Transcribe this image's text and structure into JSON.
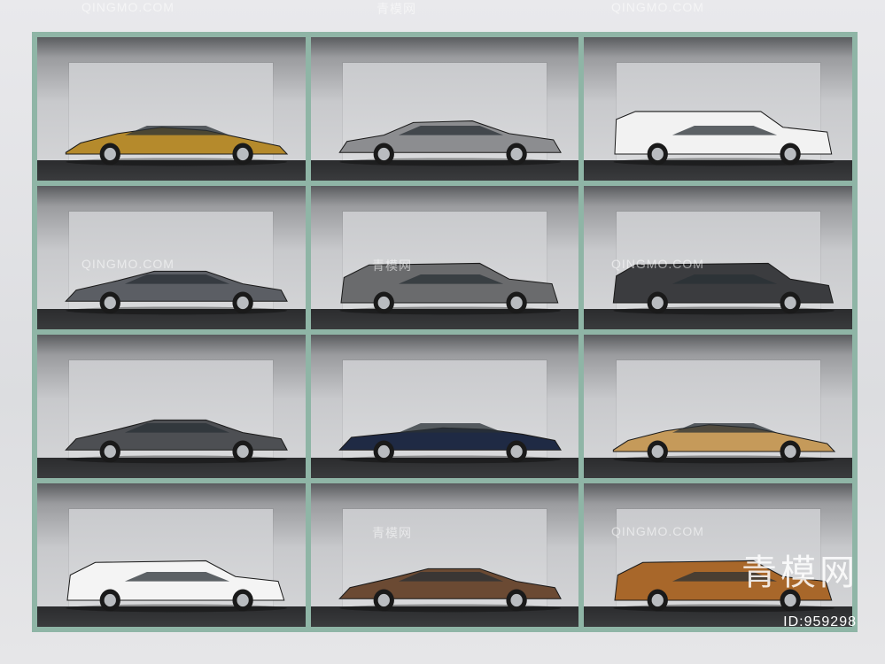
{
  "watermarks": {
    "top_left": "QINGMO.COM",
    "top_center": "青模网",
    "top_right": "QINGMO.COM",
    "row2_left": "QINGMO.COM",
    "row2_center": "青模网",
    "row2_right": "QINGMO.COM",
    "row4_center": "青模网",
    "row4_right": "QINGMO.COM"
  },
  "brand": "青模网",
  "id_label": "ID:959298",
  "cars": [
    {
      "color": "#b58a2c",
      "type": "supercar"
    },
    {
      "color": "#8c8d90",
      "type": "sedan"
    },
    {
      "color": "#f2f2f2",
      "type": "boxy-suv"
    },
    {
      "color": "#5b5e64",
      "type": "coupe"
    },
    {
      "color": "#6a6b6d",
      "type": "suv"
    },
    {
      "color": "#3b3c3f",
      "type": "wagon-suv"
    },
    {
      "color": "#4d4f53",
      "type": "coupe"
    },
    {
      "color": "#1f2a44",
      "type": "convertible"
    },
    {
      "color": "#c59a5a",
      "type": "supercar"
    },
    {
      "color": "#f4f4f4",
      "type": "suv"
    },
    {
      "color": "#6b4a33",
      "type": "coupe"
    },
    {
      "color": "#a8672a",
      "type": "suv"
    }
  ]
}
